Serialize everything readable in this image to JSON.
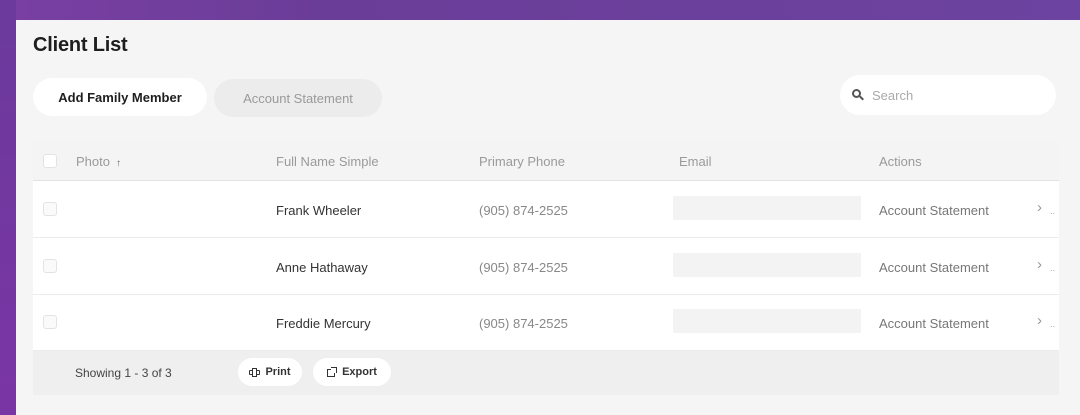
{
  "page": {
    "title": "Client List"
  },
  "toolbar": {
    "add_label": "Add Family Member",
    "statement_label": "Account Statement"
  },
  "search": {
    "placeholder": "Search",
    "value": ""
  },
  "table": {
    "columns": [
      "Photo",
      "Full Name Simple",
      "Primary Phone",
      "Email",
      "Actions"
    ],
    "sort_indicator": "↑",
    "rows": [
      {
        "name": "Frank Wheeler",
        "phone": "(905) 874-2525",
        "email": "",
        "action": "Account Statement"
      },
      {
        "name": "Anne Hathaway",
        "phone": "(905) 874-2525",
        "email": "",
        "action": "Account Statement"
      },
      {
        "name": "Freddie Mercury",
        "phone": "(905) 874-2525",
        "email": "",
        "action": "Account Statement"
      }
    ]
  },
  "footer": {
    "showing": "Showing 1 - 3 of 3",
    "print_label": "Print",
    "export_label": "Export"
  },
  "icons": {
    "search": "search-icon",
    "sort": "sort-ascending-icon",
    "row_action": "chevron-right-icon",
    "print": "printer-icon",
    "export": "external-link-icon"
  },
  "colors": {
    "frame": "#6a3d98",
    "panel_bg": "#f5f5f5",
    "header_bg": "#f4f4f4",
    "footer_bg": "#efefef"
  }
}
